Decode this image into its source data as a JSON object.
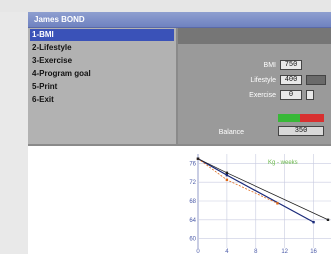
{
  "window": {
    "title": "James BOND"
  },
  "menu": {
    "items": [
      {
        "label": "1-BMI",
        "active": true
      },
      {
        "label": "2-Lifestyle",
        "active": false
      },
      {
        "label": "3-Exercise",
        "active": false
      },
      {
        "label": "4-Program goal",
        "active": false
      },
      {
        "label": "5-Print",
        "active": false
      },
      {
        "label": "6-Exit",
        "active": false
      }
    ]
  },
  "panel": {
    "bmi_label": "BMI",
    "bmi_value": "750",
    "lifestyle_label": "Lifestyle",
    "lifestyle_value": "400",
    "exercise_label": "Exercise",
    "exercise_value": "0",
    "balance_label": "Balance",
    "balance_value": "350"
  },
  "colors": {
    "accent": "#3a52b8",
    "balance_green": "#38b838",
    "balance_red": "#d83030"
  },
  "chart_data": {
    "type": "line",
    "legend": "Kg - weeks",
    "x_ticks": [
      "0",
      "4",
      "8",
      "12",
      "16"
    ],
    "y_ticks": [
      "76",
      "72",
      "68",
      "64",
      "60"
    ],
    "ylim": [
      58,
      78
    ],
    "xlim": [
      0,
      18
    ],
    "series": [
      {
        "name": "",
        "color": "#1a2a7a",
        "x": [
          0,
          4,
          16
        ],
        "y": [
          77,
          73.5,
          63.5
        ]
      },
      {
        "name": "",
        "color": "#e06a1a",
        "x": [
          0,
          4,
          11
        ],
        "y": [
          77,
          72.5,
          67.5
        ]
      },
      {
        "name": "",
        "color": "#202020",
        "x": [
          0,
          4,
          18
        ],
        "y": [
          77,
          74,
          64
        ]
      }
    ]
  }
}
